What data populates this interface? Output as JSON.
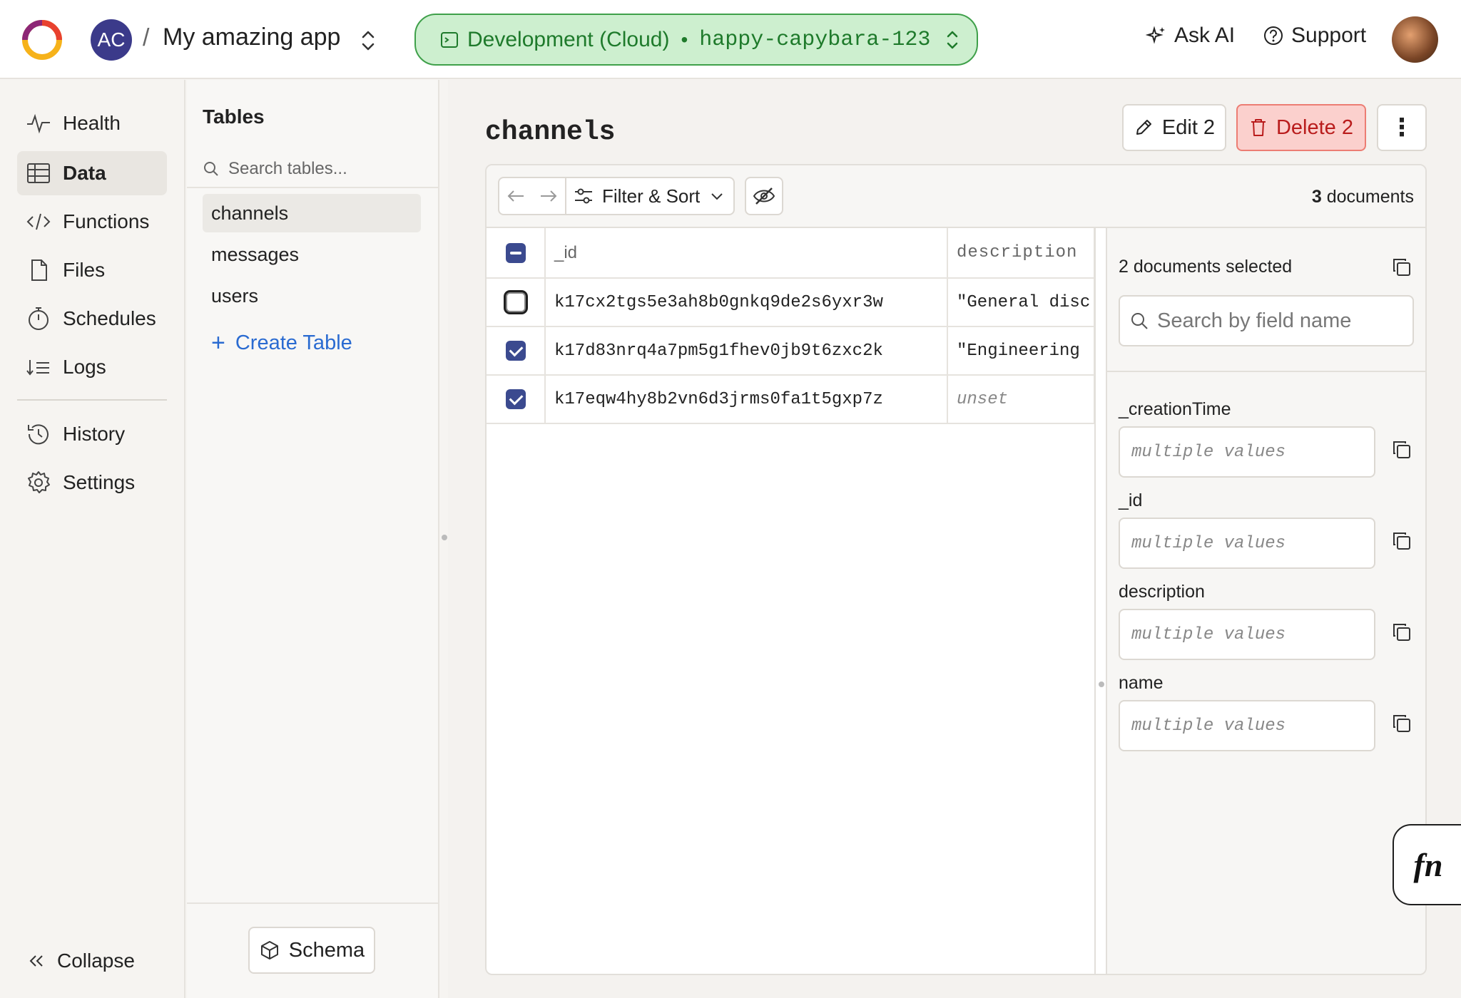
{
  "header": {
    "team_initials": "AC",
    "separator": "/",
    "project_name": "My amazing app",
    "deployment_name": "Development (Cloud)",
    "deployment_separator": "•",
    "deployment_slug": "happy-capybara-123",
    "ask_ai_label": "Ask AI",
    "support_label": "Support"
  },
  "nav": {
    "items": [
      {
        "label": "Health",
        "icon": "pulse-icon"
      },
      {
        "label": "Data",
        "icon": "table-icon"
      },
      {
        "label": "Functions",
        "icon": "code-icon"
      },
      {
        "label": "Files",
        "icon": "file-icon"
      },
      {
        "label": "Schedules",
        "icon": "stopwatch-icon"
      },
      {
        "label": "Logs",
        "icon": "logs-icon"
      },
      {
        "label": "History",
        "icon": "history-icon"
      },
      {
        "label": "Settings",
        "icon": "gear-icon"
      }
    ],
    "active": "Data",
    "collapse_label": "Collapse"
  },
  "tables_panel": {
    "title": "Tables",
    "search_placeholder": "Search tables...",
    "tables": [
      "channels",
      "messages",
      "users"
    ],
    "active_table": "channels",
    "create_label": "Create Table",
    "schema_label": "Schema"
  },
  "main": {
    "title": "channels",
    "edit_label": "Edit 2",
    "delete_label": "Delete 2",
    "more_label": "⋮",
    "filter_sort_label": "Filter & Sort",
    "doc_count": "3",
    "doc_count_suffix": "documents",
    "columns": [
      "_id",
      "description"
    ],
    "rows": [
      {
        "checked": false,
        "id": "k17cx2tgs5e3ah8b0gnkq9de2s6yxr3w",
        "description": "\"General disc"
      },
      {
        "checked": true,
        "id": "k17d83nrq4a7pm5g1fhev0jb9t6zxc2k",
        "description": "\"Engineering "
      },
      {
        "checked": true,
        "id": "k17eqw4hy8b2vn6d3jrms0fa1t5gxp7z",
        "description": "unset"
      }
    ]
  },
  "side_panel": {
    "selected_text": "2 documents selected",
    "search_placeholder": "Search by field name",
    "fields": [
      {
        "label": "_creationTime",
        "value": "multiple values"
      },
      {
        "label": "_id",
        "value": "multiple values"
      },
      {
        "label": "description",
        "value": "multiple values"
      },
      {
        "label": "name",
        "value": "multiple values"
      }
    ]
  },
  "fn_button_label": "fn",
  "colors": {
    "accent_blue": "#2a6bd1",
    "deployment_green": "#1e7a2b",
    "deployment_bg": "#cdefcf",
    "danger_red": "#b91c1c",
    "danger_bg": "#fbd0cd",
    "checkbox": "#3b4a8f"
  }
}
